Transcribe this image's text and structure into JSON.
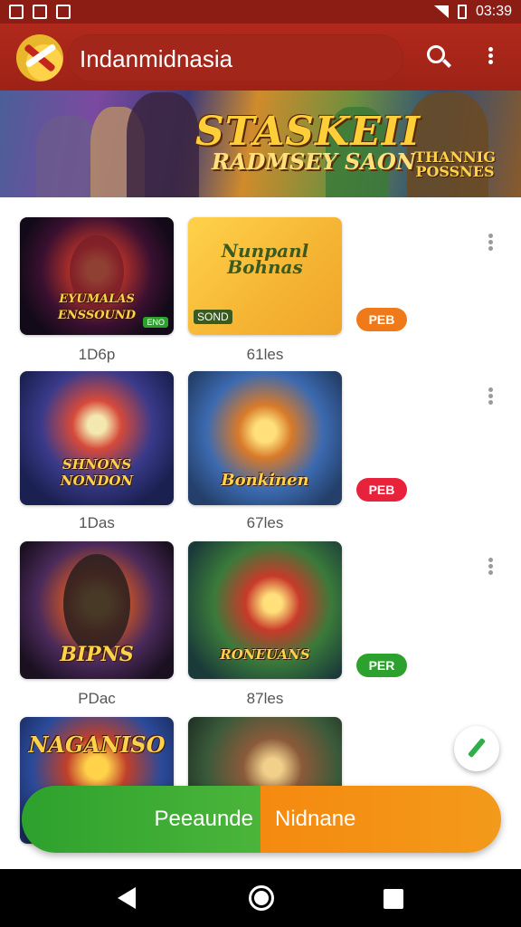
{
  "status_bar": {
    "time": "03:39"
  },
  "toolbar": {
    "title": "Indanmidnasia"
  },
  "banner": {
    "headline": "STASKEII",
    "subline": "RADMSEY SAON",
    "side_text": "THANNIG POSSNES"
  },
  "rows": [
    {
      "cards": [
        {
          "title": "EYUMALAS ENSSOUND",
          "tag": "ENO",
          "caption": "1D6p"
        },
        {
          "title": "Nunpanl Bohnas",
          "tag": "SOND",
          "caption": "61les"
        }
      ],
      "badge": "PEB",
      "badge_color": "#f07a1a"
    },
    {
      "cards": [
        {
          "title": "SHNONS NONDON",
          "tag": "",
          "caption": "1Das"
        },
        {
          "title": "Bonkinen",
          "tag": "",
          "caption": "67les"
        }
      ],
      "badge": "PEB",
      "badge_color": "#e8223a"
    },
    {
      "cards": [
        {
          "title": "BIPNS",
          "tag": "",
          "caption": "PDac"
        },
        {
          "title": "RONEUANS",
          "tag": "",
          "caption": "87les"
        }
      ],
      "badge": "PER",
      "badge_color": "#2da12d"
    },
    {
      "cards": [
        {
          "title": "NAGANISO",
          "tag": "",
          "caption": ""
        },
        {
          "title": "",
          "tag": "",
          "caption": ""
        }
      ],
      "badge": "",
      "badge_color": ""
    }
  ],
  "action_bar": {
    "left_label": "Peeaunde",
    "right_label": "Nidnane"
  },
  "icons": {
    "search": "search-icon",
    "more": "more-vert-icon",
    "edit": "pencil-icon",
    "back": "back-icon",
    "home": "home-icon",
    "recents": "recents-icon"
  },
  "colors": {
    "toolbar": "#b0291c",
    "status_bar": "#8c1d14",
    "action_left": "#2da12d",
    "action_right": "#f58a10"
  }
}
